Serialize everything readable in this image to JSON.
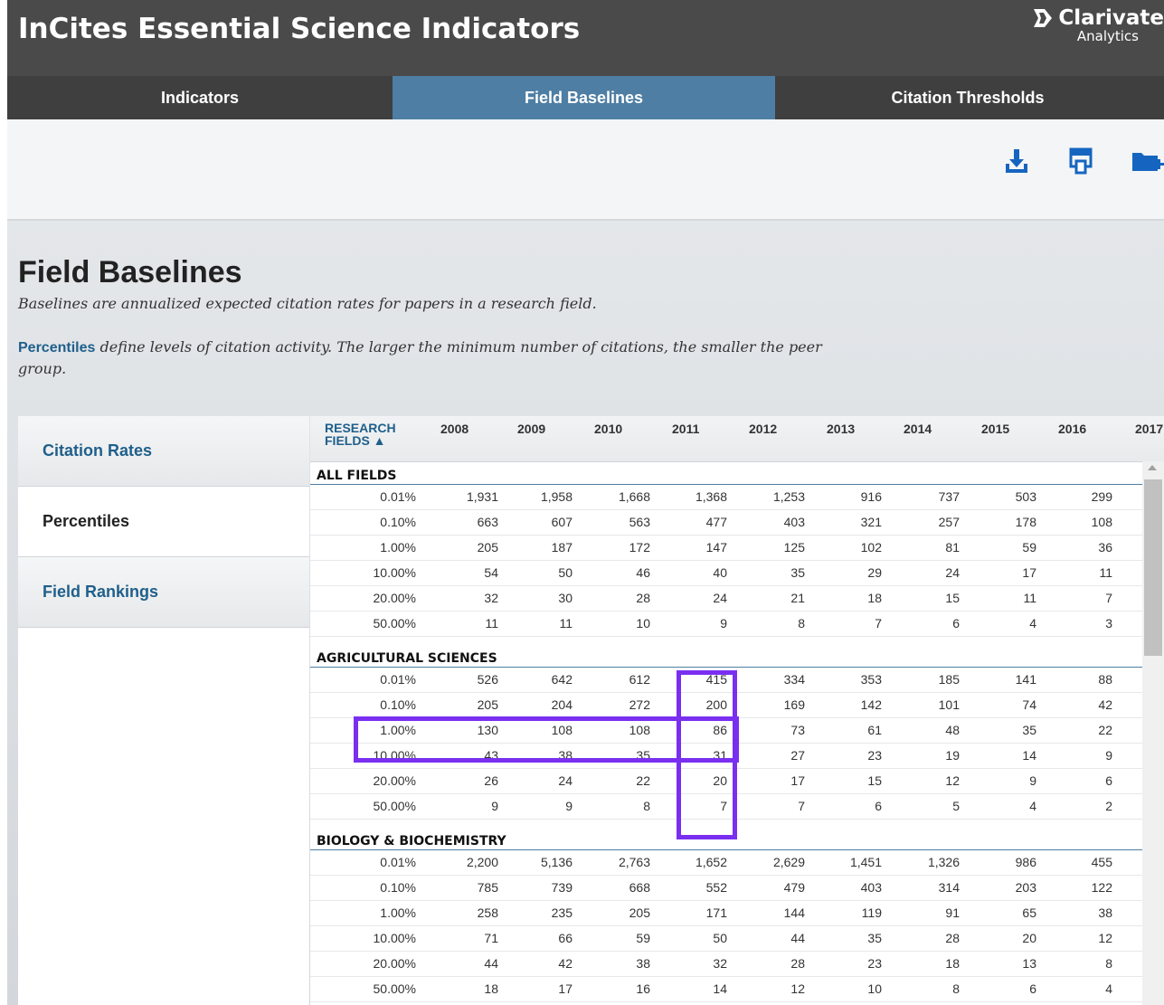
{
  "header": {
    "title": "InCites Essential Science Indicators",
    "brand_name": "Clarivate",
    "brand_sub": "Analytics"
  },
  "nav": {
    "tabs": [
      {
        "label": "Indicators",
        "active": false
      },
      {
        "label": "Field Baselines",
        "active": true
      },
      {
        "label": "Citation Thresholds",
        "active": false
      }
    ]
  },
  "toolbar": {
    "icons": [
      "download-icon",
      "print-icon",
      "add-to-folder-icon"
    ],
    "accent": "#1565c0"
  },
  "page": {
    "heading": "Field Baselines",
    "description": "Baselines are annualized expected citation rates for papers in a research field.",
    "percentiles_link": "Percentiles",
    "percentiles_desc": " define levels of citation activity. The larger the minimum number of citations, the smaller the peer group."
  },
  "sidebar": {
    "items": [
      {
        "label": "Citation Rates",
        "active": false
      },
      {
        "label": "Percentiles",
        "active": true
      },
      {
        "label": "Field Rankings",
        "active": false
      }
    ]
  },
  "table": {
    "first_header": "RESEARCH FIELDS",
    "first_header_line1": "RESEARCH",
    "first_header_line2": "FIELDS ▲",
    "years": [
      "2008",
      "2009",
      "2010",
      "2011",
      "2012",
      "2013",
      "2014",
      "2015",
      "2016",
      "2017"
    ],
    "groups": [
      {
        "name": "ALL FIELDS",
        "rows": [
          {
            "percentile": "0.01%",
            "values": [
              "1,931",
              "1,958",
              "1,668",
              "1,368",
              "1,253",
              "916",
              "737",
              "503",
              "299"
            ]
          },
          {
            "percentile": "0.10%",
            "values": [
              "663",
              "607",
              "563",
              "477",
              "403",
              "321",
              "257",
              "178",
              "108"
            ]
          },
          {
            "percentile": "1.00%",
            "values": [
              "205",
              "187",
              "172",
              "147",
              "125",
              "102",
              "81",
              "59",
              "36"
            ]
          },
          {
            "percentile": "10.00%",
            "values": [
              "54",
              "50",
              "46",
              "40",
              "35",
              "29",
              "24",
              "17",
              "11"
            ]
          },
          {
            "percentile": "20.00%",
            "values": [
              "32",
              "30",
              "28",
              "24",
              "21",
              "18",
              "15",
              "11",
              "7"
            ]
          },
          {
            "percentile": "50.00%",
            "values": [
              "11",
              "11",
              "10",
              "9",
              "8",
              "7",
              "6",
              "4",
              "3"
            ]
          }
        ]
      },
      {
        "name": "AGRICULTURAL SCIENCES",
        "rows": [
          {
            "percentile": "0.01%",
            "values": [
              "526",
              "642",
              "612",
              "415",
              "334",
              "353",
              "185",
              "141",
              "88"
            ]
          },
          {
            "percentile": "0.10%",
            "values": [
              "205",
              "204",
              "272",
              "200",
              "169",
              "142",
              "101",
              "74",
              "42"
            ]
          },
          {
            "percentile": "1.00%",
            "values": [
              "130",
              "108",
              "108",
              "86",
              "73",
              "61",
              "48",
              "35",
              "22"
            ]
          },
          {
            "percentile": "10.00%",
            "values": [
              "43",
              "38",
              "35",
              "31",
              "27",
              "23",
              "19",
              "14",
              "9"
            ]
          },
          {
            "percentile": "20.00%",
            "values": [
              "26",
              "24",
              "22",
              "20",
              "17",
              "15",
              "12",
              "9",
              "6"
            ]
          },
          {
            "percentile": "50.00%",
            "values": [
              "9",
              "9",
              "8",
              "7",
              "7",
              "6",
              "5",
              "4",
              "2"
            ]
          }
        ]
      },
      {
        "name": "BIOLOGY & BIOCHEMISTRY",
        "rows": [
          {
            "percentile": "0.01%",
            "values": [
              "2,200",
              "5,136",
              "2,763",
              "1,652",
              "2,629",
              "1,451",
              "1,326",
              "986",
              "455"
            ]
          },
          {
            "percentile": "0.10%",
            "values": [
              "785",
              "739",
              "668",
              "552",
              "479",
              "403",
              "314",
              "203",
              "122"
            ]
          },
          {
            "percentile": "1.00%",
            "values": [
              "258",
              "235",
              "205",
              "171",
              "144",
              "119",
              "91",
              "65",
              "38"
            ]
          },
          {
            "percentile": "10.00%",
            "values": [
              "71",
              "66",
              "59",
              "50",
              "44",
              "35",
              "28",
              "20",
              "12"
            ]
          },
          {
            "percentile": "20.00%",
            "values": [
              "44",
              "42",
              "38",
              "32",
              "28",
              "23",
              "18",
              "13",
              "8"
            ]
          },
          {
            "percentile": "50.00%",
            "values": [
              "18",
              "17",
              "16",
              "14",
              "12",
              "10",
              "8",
              "6",
              "4"
            ]
          }
        ]
      }
    ]
  },
  "annotation": {
    "color": "#7a2ff0"
  }
}
